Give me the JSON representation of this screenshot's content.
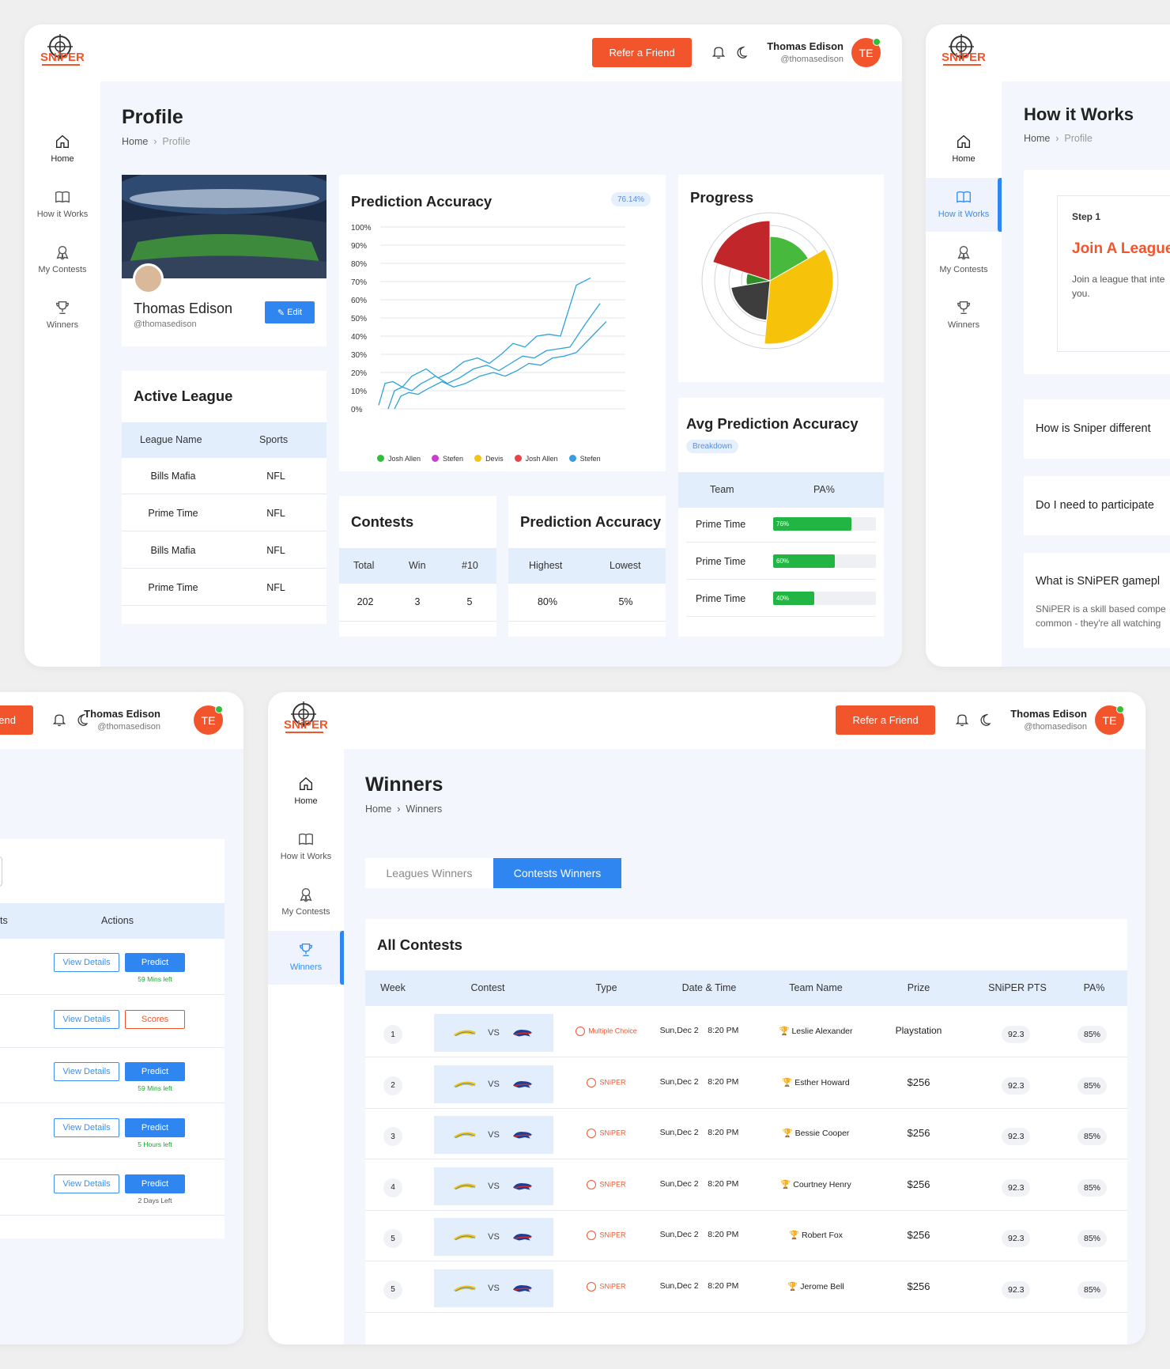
{
  "brand": {
    "logo_text": "SNiPER",
    "accent": "#f2552c",
    "primary": "#2f86f0"
  },
  "header": {
    "refer_label": "Refer a Friend",
    "user_name": "Thomas Edison",
    "user_handle": "@thomasedison",
    "avatar_initials": "TE",
    "bell_icon": "bell-icon",
    "theme_icon": "moon-icon"
  },
  "nav": [
    {
      "label": "Home",
      "icon": "home-icon"
    },
    {
      "label": "How it Works",
      "icon": "book-icon"
    },
    {
      "label": "My Contests",
      "icon": "badge-icon"
    },
    {
      "label": "Winners",
      "icon": "trophy-icon"
    }
  ],
  "profile": {
    "title": "Profile",
    "bc_home": "Home",
    "bc_current": "Profile",
    "name": "Thomas Edison",
    "handle": "@thomasedison",
    "edit_label": "Edit",
    "accuracy_title": "Prediction Accuracy",
    "accuracy_badge": "76.14%",
    "chart_data": {
      "type": "line",
      "ylabels": [
        "100%",
        "90%",
        "80%",
        "70%",
        "60%",
        "50%",
        "40%",
        "30%",
        "20%",
        "10%",
        "0%"
      ],
      "ylim": [
        0,
        100
      ],
      "legend": [
        {
          "name": "Josh Allen",
          "color": "#2fbf3a"
        },
        {
          "name": "Stefen",
          "color": "#c83fcf"
        },
        {
          "name": "Devis",
          "color": "#f0c419"
        },
        {
          "name": "Josh Allen",
          "color": "#e8434b"
        },
        {
          "name": "Stefen",
          "color": "#3b9be0"
        }
      ],
      "series": [
        {
          "values": [
            2,
            14,
            15,
            12,
            18,
            22,
            17,
            20,
            26,
            28,
            25,
            30,
            36,
            34,
            40,
            41,
            40,
            68,
            72
          ]
        },
        {
          "values": [
            0,
            10,
            12,
            10,
            14,
            18,
            14,
            17,
            22,
            24,
            21,
            25,
            29,
            28,
            32,
            33,
            34,
            47,
            58
          ]
        },
        {
          "values": [
            0,
            7,
            9,
            8,
            11,
            15,
            12,
            14,
            18,
            20,
            18,
            21,
            25,
            24,
            28,
            29,
            31,
            40,
            48
          ]
        }
      ]
    },
    "progress_title": "Progress",
    "progress_data": {
      "type": "pie",
      "slices": [
        {
          "color": "#c0262a",
          "radius": 76
        },
        {
          "color": "#47b93c",
          "radius": 56
        },
        {
          "color": "#f7c30a",
          "radius": 80
        },
        {
          "color": "#3d3d3d",
          "radius": 50
        },
        {
          "color": "#2d8f25",
          "radius": 30
        }
      ]
    },
    "avg_title": "Avg Prediction Accuracy",
    "avg_badge": "Breakdown",
    "avg_headers": [
      "Team",
      "PA%"
    ],
    "avg_rows": [
      {
        "team": "Prime Time",
        "pa": "76%",
        "value": 76
      },
      {
        "team": "Prime Time",
        "pa": "60%",
        "value": 60
      },
      {
        "team": "Prime Time",
        "pa": "40%",
        "value": 40
      }
    ],
    "league_title": "Active  League",
    "league_headers": [
      "League Name",
      "Sports"
    ],
    "leagues": [
      {
        "name": "Bills Mafia",
        "sport": "NFL"
      },
      {
        "name": "Prime Time",
        "sport": "NFL"
      },
      {
        "name": "Bills Mafia",
        "sport": "NFL"
      },
      {
        "name": "Prime Time",
        "sport": "NFL"
      }
    ],
    "contests_title": "Contests",
    "contests_headers": [
      "Total",
      "Win",
      "#10"
    ],
    "contests_values": [
      "202",
      "3",
      "5"
    ],
    "pa_title": "Prediction Accuracy",
    "pa_headers": [
      "Highest",
      "Lowest"
    ],
    "pa_values": [
      "80%",
      "5%"
    ]
  },
  "how": {
    "title": "How it Works",
    "bc_home": "Home",
    "bc_current": "Profile",
    "step": "Step 1",
    "step_title": "Join A League",
    "step_text": "Join a league that inte you.",
    "faqs": [
      "How is Sniper different",
      "Do I need to participate",
      "What is SNiPER gamepl"
    ],
    "faq_text": "SNiPER is a skill based compe common - they're all watching"
  },
  "contests": {
    "partial_refer": "end",
    "actions_header": "Actions",
    "partial_header": "ts",
    "rows": [
      {
        "view": "View Details",
        "action": "Predict",
        "time": "59 Mins left"
      },
      {
        "view": "View Details",
        "action": "Scores",
        "time": ""
      },
      {
        "view": "View Details",
        "action": "Predict",
        "time": "59 Mins left"
      },
      {
        "view": "View Details",
        "action": "Predict",
        "time": "5 Hours left"
      },
      {
        "view": "View Details",
        "action": "Predict",
        "time": "2 Days Left"
      }
    ]
  },
  "winners": {
    "title": "Winners",
    "bc_home": "Home",
    "bc_current": "Winners",
    "tab_leagues": "Leagues Winners",
    "tab_contests": "Contests Winners",
    "table_title": "All Contests",
    "headers": [
      "Week",
      "Contest",
      "Type",
      "Date & Time",
      "Team Name",
      "Prize",
      "SNiPER PTS",
      "PA%"
    ],
    "vs": "VS",
    "rows": [
      {
        "week": "1",
        "type": "Multiple Choice",
        "date": "Sun,Dec 2",
        "time": "8:20 PM",
        "team": "Leslie Alexander",
        "prize": "Playstation",
        "pts": "92.3",
        "pa": "85%"
      },
      {
        "week": "2",
        "type": "SNiPER",
        "date": "Sun,Dec 2",
        "time": "8:20 PM",
        "team": "Esther Howard",
        "prize": "$256",
        "pts": "92.3",
        "pa": "85%"
      },
      {
        "week": "3",
        "type": "SNiPER",
        "date": "Sun,Dec 2",
        "time": "8:20 PM",
        "team": "Bessie Cooper",
        "prize": "$256",
        "pts": "92.3",
        "pa": "85%"
      },
      {
        "week": "4",
        "type": "SNiPER",
        "date": "Sun,Dec 2",
        "time": "8:20 PM",
        "team": "Courtney Henry",
        "prize": "$256",
        "pts": "92.3",
        "pa": "85%"
      },
      {
        "week": "5",
        "type": "SNiPER",
        "date": "Sun,Dec 2",
        "time": "8:20 PM",
        "team": "Robert Fox",
        "prize": "$256",
        "pts": "92.3",
        "pa": "85%"
      },
      {
        "week": "5",
        "type": "SNiPER",
        "date": "Sun,Dec 2",
        "time": "8:20 PM",
        "team": "Jerome Bell",
        "prize": "$256",
        "pts": "92.3",
        "pa": "85%"
      }
    ]
  }
}
